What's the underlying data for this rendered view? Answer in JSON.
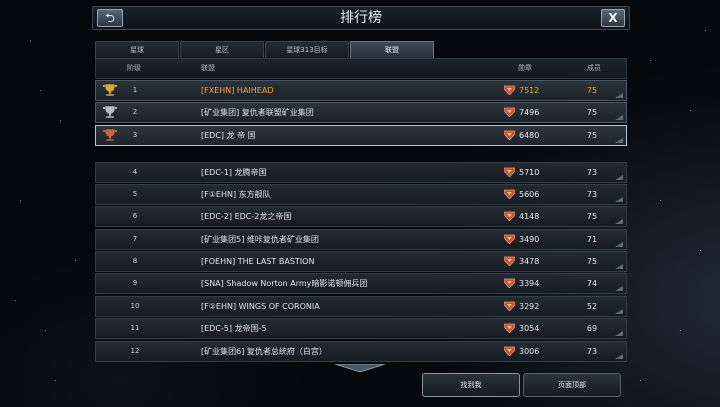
{
  "window": {
    "title": "排行榜",
    "back_label": "⮌",
    "close_label": "X"
  },
  "tabs": [
    {
      "label": "星球",
      "active": false
    },
    {
      "label": "星区",
      "active": false
    },
    {
      "label": "星球313目标",
      "active": false
    },
    {
      "label": "联盟",
      "active": true
    }
  ],
  "table": {
    "headers": {
      "rank": "阶级",
      "alliance": "联盟",
      "medals": "勋章",
      "members": "成员"
    },
    "rows": [
      {
        "rank": "1",
        "name": "[FXEHN] HAIHEAD",
        "medals": "7512",
        "members": "75",
        "highlight": true,
        "rank_icon": "gold-trophy-icon"
      },
      {
        "rank": "2",
        "name": "[矿业集团] 复仇者联盟矿业集团",
        "medals": "7496",
        "members": "75",
        "highlight": false,
        "rank_icon": "silver-trophy-icon"
      },
      {
        "rank": "3",
        "name": "[EDC] 龙 帝 国",
        "medals": "6480",
        "members": "75",
        "highlight": false,
        "rank_icon": "bronze-trophy-icon"
      },
      {
        "rank": "4",
        "name": "[EDC-1] 龙腾帝国",
        "medals": "5710",
        "members": "73"
      },
      {
        "rank": "5",
        "name": "[F①EHN] 东方舰队",
        "medals": "5606",
        "members": "73"
      },
      {
        "rank": "6",
        "name": "[EDC-2] EDC-2龙之帝国",
        "medals": "4148",
        "members": "75"
      },
      {
        "rank": "7",
        "name": "[矿业集团5] 维咔复仇者矿业集团",
        "medals": "3490",
        "members": "71"
      },
      {
        "rank": "8",
        "name": "[FOEHN] THE LAST BASTION",
        "medals": "3478",
        "members": "75"
      },
      {
        "rank": "9",
        "name": "[SNA] Shadow Norton Army暗影诺顿佣兵团",
        "medals": "3394",
        "members": "74"
      },
      {
        "rank": "10",
        "name": "[F②EHN] WINGS OF CORONIA",
        "medals": "3292",
        "members": "52"
      },
      {
        "rank": "11",
        "name": "[EDC-5] 龙帝国-5",
        "medals": "3054",
        "members": "69"
      },
      {
        "rank": "12",
        "name": "[矿业集团6] 复仇者总统府（白宫）",
        "medals": "3006",
        "members": "73"
      }
    ]
  },
  "buttons": {
    "find_me": "找到我",
    "page_top": "页面顶部"
  },
  "colors": {
    "gold_text": "#f0a63a",
    "medal_icon": "#c2553a"
  }
}
